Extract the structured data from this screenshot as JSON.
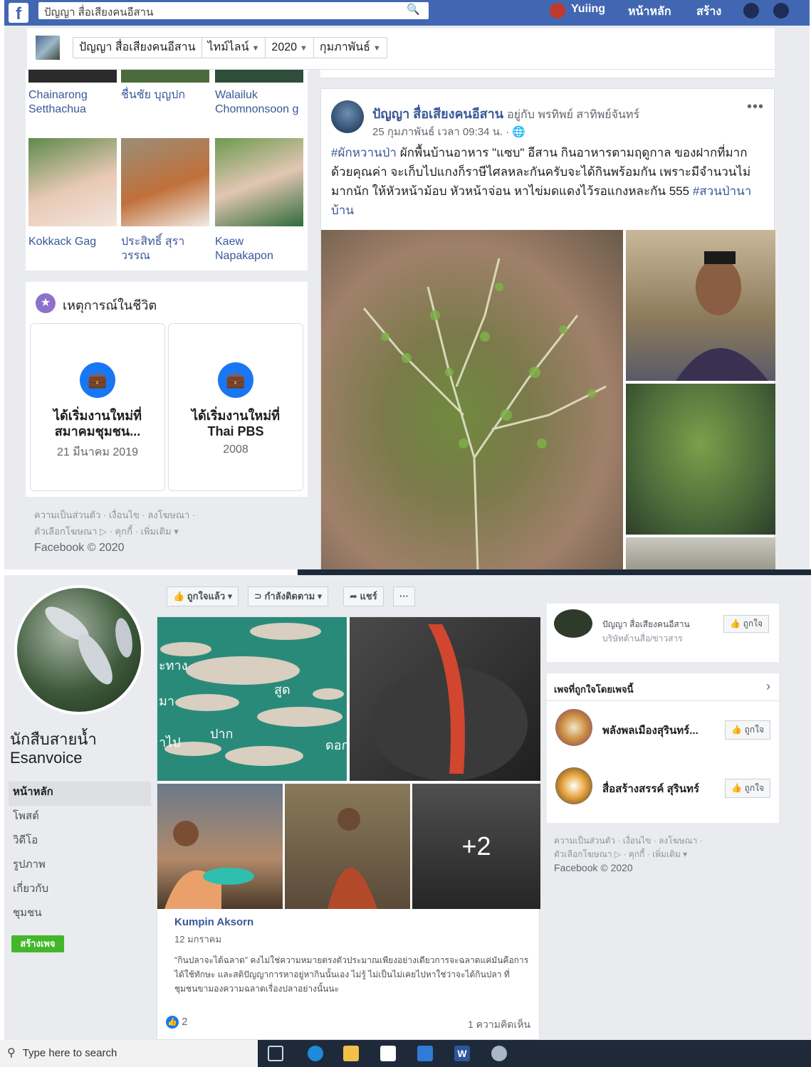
{
  "top": {
    "header": {
      "logo": "f",
      "search_value": "ปัญญา สื่อเสียงคนอีสาน",
      "user_name": "Yuiing",
      "nav_home": "หน้าหลัก",
      "nav_create": "สร้าง"
    },
    "breadcrumbs": [
      {
        "label": "ปัญญา สื่อเสียงคนอีสาน",
        "arrow": ""
      },
      {
        "label": "ไทม์ไลน์",
        "arrow": "▼"
      },
      {
        "label": "2020",
        "arrow": "▼"
      },
      {
        "label": "กุมภาพันธ์",
        "arrow": "▼"
      }
    ],
    "friends": [
      {
        "name": "Chainarong Setthachua"
      },
      {
        "name": "ชื่นชัย บุญปก"
      },
      {
        "name": "Walailuk Chomnonsoon g"
      },
      {
        "name": "Kokkack Gag"
      },
      {
        "name": "ประสิทธิ์ สุรา วรรณ"
      },
      {
        "name": "Kaew Napakapon"
      }
    ],
    "life_events": {
      "title": "เหตุการณ์ในชีวิต",
      "items": [
        {
          "title": "ได้เริ่มงานใหม่ที่ สมาคมชุมชน...",
          "date": "21 มีนาคม 2019"
        },
        {
          "title": "ได้เริ่มงานใหม่ที่ Thai PBS",
          "date": "2008"
        }
      ]
    },
    "footer": {
      "line1": "ความเป็นส่วนตัว · เงื่อนไข · ลงโฆษณา ·",
      "line2": "ตัวเลือกโฆษณา ▷ · คุกกี้ · เพิ่มเติม ▾",
      "copyright": "Facebook © 2020"
    },
    "post": {
      "author": "ปัญญา สื่อเสียงคนอีสาน",
      "with": "อยู่กับ พรทิพย์ สาทิพย์จันทร์",
      "time": "25 กุมภาพันธ์ เวลา 09:34 น. · 🌐",
      "more": "•••",
      "tag1": "#ผักหวานป่า",
      "body": " ผักพื้นบ้านอาหาร \"แซบ\" อีสาน กินอาหารตามฤดูกาล ของฝากที่มากด้วยคุณค่า จะเก็บไปแกงก็ราษีไศลหละกันครับจะได้กินพร้อมกัน เพราะมีจำนวนไม่มากนัก ให้หัวหน้าม้อบ หัวหน้าจ่อน หาไข่มดแดงไว้รอแกงหละกัน 555 ",
      "tag2": "#สวนป่านาบ้าน"
    }
  },
  "bottom": {
    "page_name_line1": "นักสืบสายน้ำ",
    "page_name_line2": "Esanvoice",
    "side_nav": [
      {
        "label": "หน้าหลัก",
        "active": true
      },
      {
        "label": "โพสต์"
      },
      {
        "label": "วิดีโอ"
      },
      {
        "label": "รูปภาพ"
      },
      {
        "label": "เกี่ยวกับ"
      },
      {
        "label": "ชุมชน"
      }
    ],
    "create_button": "สร้างเพจ",
    "actions": {
      "like": "👍 ถูกใจแล้ว ▾",
      "follow": "⊃ กำลังติดตาม ▾",
      "share": "➦ แชร์",
      "more": "···"
    },
    "photo_labels": [
      "ะทาง",
      "สูด",
      "มา",
      "ปาก",
      "าไป",
      "ดอก"
    ],
    "plus_more": "+2",
    "post": {
      "author": "Kumpin Aksorn",
      "date": "12 มกราคม",
      "text": "\"กินปลาจะได้ฉลาด\" คงไม่ใช่ความหมายตรงตัวประมาณเพียงอย่างเดียวการจะฉลาดแค่มันคือการได้ใช้ทักษะ และสติปัญญาการหาอยู่หากินนั้นเอง ไม่รู้ ไม่เป็นไม่เคยไปหาใช่ว่าจะได้กินปลา ที่ชุมชนขามองความฉลาดเรื่องปลาอย่างนั้นนะ",
      "reactions": "2",
      "comments": "1 ความคิดเห็น"
    },
    "right_card1": {
      "name": "ปัญญา สื่อเสียงคนอีสาน",
      "sub": "บริษัทด้านสื่อ/ข่าวสาร",
      "like": "👍 ถูกใจ"
    },
    "liked_pages": {
      "title": "เพจที่ถูกใจโดยเพจนี้",
      "chevron": "›",
      "items": [
        {
          "name": "พลังพลเมืองสุรินทร์...",
          "like": "👍 ถูกใจ"
        },
        {
          "name": "สื่อสร้างสรรค์ สุรินทร์",
          "like": "👍 ถูกใจ"
        }
      ]
    },
    "footer": {
      "line1": "ความเป็นส่วนตัว · เงื่อนไข · ลงโฆษณา ·",
      "line2": "ตัวเลือกโฆษณา ▷ · คุกกี้ · เพิ่มเติม ▾",
      "copyright": "Facebook © 2020"
    }
  },
  "taskbar": {
    "search_placeholder": "Type here to search",
    "icons": [
      "task-view-icon",
      "edge-icon",
      "file-explorer-icon",
      "store-icon",
      "mail-icon",
      "word-icon",
      "photos-icon"
    ]
  },
  "colors": {
    "fb_blue": "#4267b2",
    "link_blue": "#385898",
    "page_bg": "#e9ebee",
    "green_button": "#42b72a",
    "taskbar": "#1e2a3a"
  }
}
